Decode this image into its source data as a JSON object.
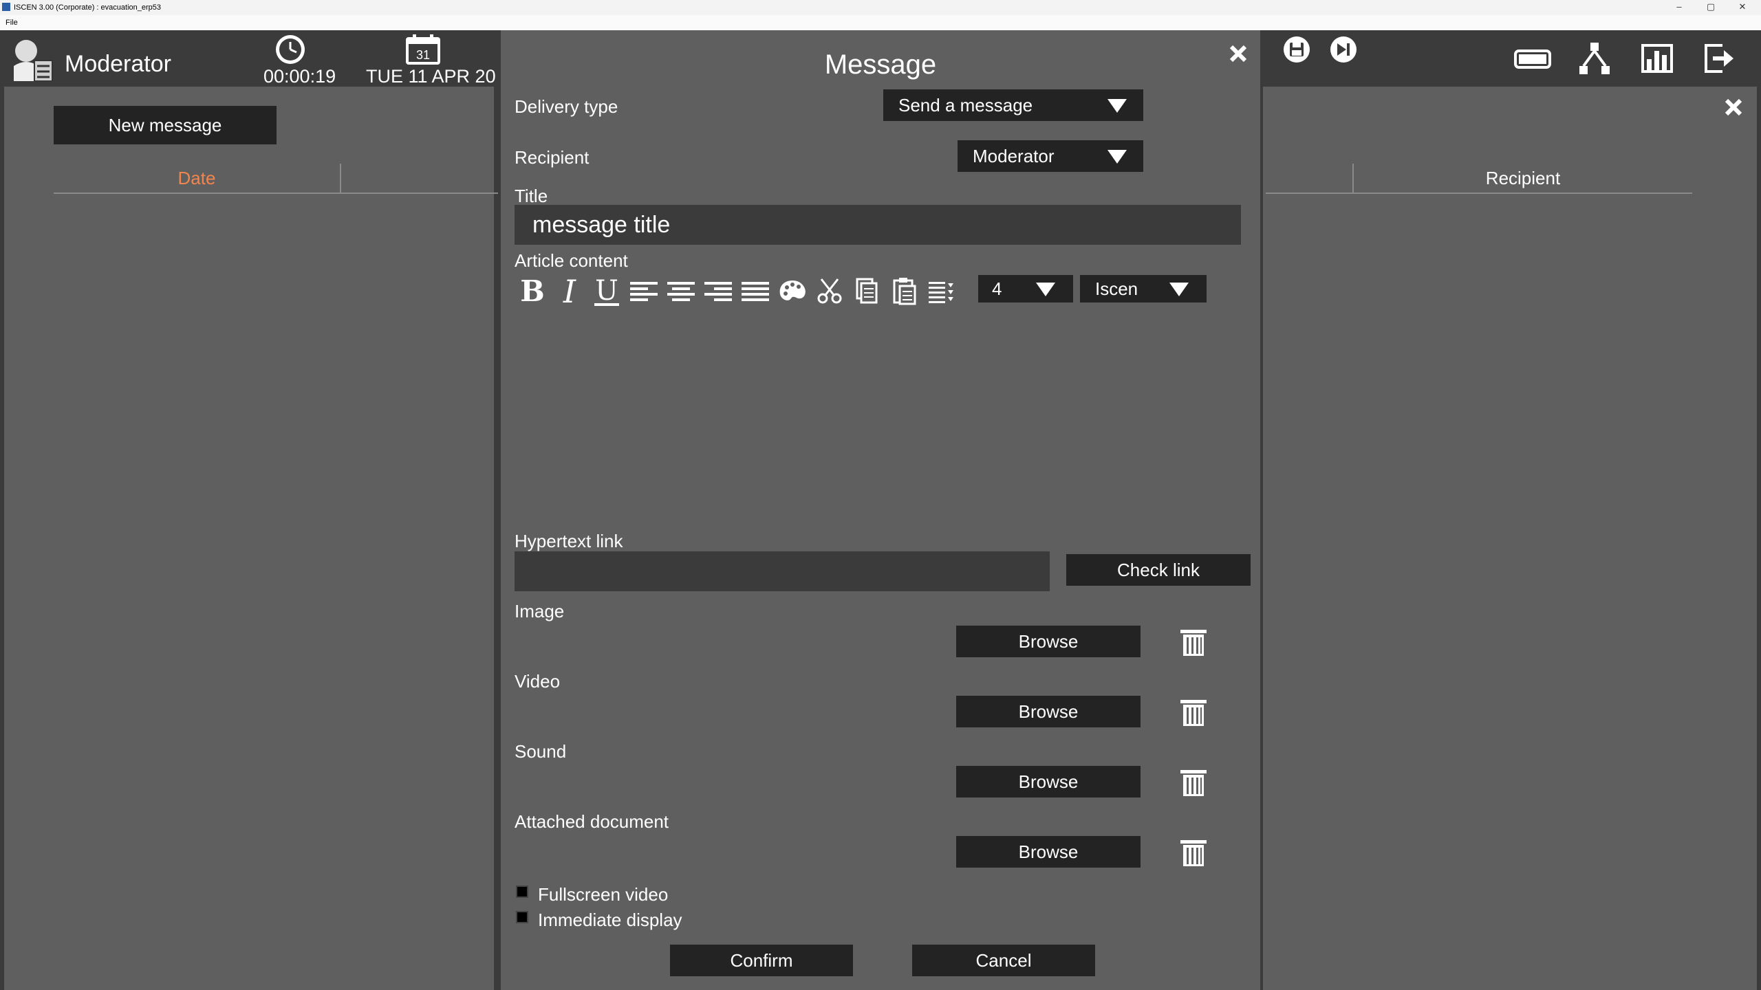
{
  "window": {
    "title": "ISCEN  3.00 (Corporate) : evacuation_erp53",
    "menu_file": "File",
    "min": "–",
    "max": "▢",
    "close": "✕"
  },
  "header": {
    "role": "Moderator",
    "timer": "00:00:19",
    "calendar_day": "31",
    "date": "TUE 11 APR 20"
  },
  "left": {
    "new_message": "New message",
    "col_date": "Date"
  },
  "right": {
    "col_recipient": "Recipient"
  },
  "modal": {
    "title": "Message",
    "delivery_type_label": "Delivery type",
    "delivery_type_value": "Send a message",
    "recipient_label": "Recipient",
    "recipient_value": "Moderator",
    "title_label": "Title",
    "title_value": "message title",
    "content_label": "Article content",
    "font_size": "4",
    "font_name": "Iscen",
    "hyperlink_label": "Hypertext link",
    "check_link": "Check link",
    "image_label": "Image",
    "video_label": "Video",
    "sound_label": "Sound",
    "document_label": "Attached document",
    "browse": "Browse",
    "fullscreen_video": "Fullscreen video",
    "immediate_display": "Immediate display",
    "confirm": "Confirm",
    "cancel": "Cancel"
  },
  "colors": {
    "panel": "#5f5f5f",
    "bar": "#3b3b3b",
    "button": "#232323",
    "accent": "#f0854e"
  }
}
